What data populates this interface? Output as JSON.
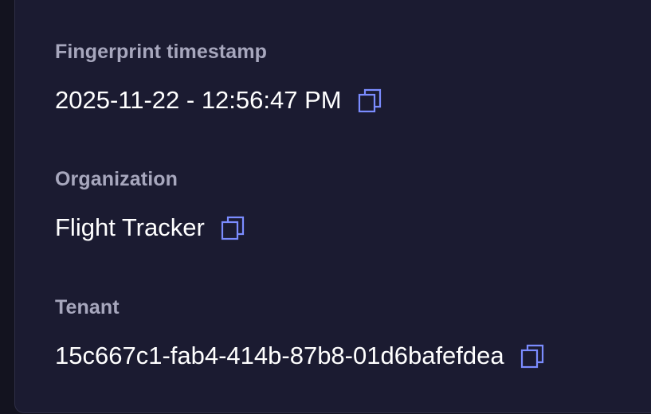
{
  "fields": [
    {
      "label": "Fingerprint timestamp",
      "value": "2025-11-22 - 12:56:47 PM",
      "icon": "copy-icon"
    },
    {
      "label": "Organization",
      "value": "Flight Tracker",
      "icon": "copy-icon"
    },
    {
      "label": "Tenant",
      "value": "15c667c1-fab4-414b-87b8-01d6bafefdea",
      "icon": "copy-icon"
    }
  ],
  "colors": {
    "background": "#13131f",
    "card": "#1b1b31",
    "label": "#a7a7bd",
    "value": "#ffffff",
    "icon": "#7b8cff"
  }
}
